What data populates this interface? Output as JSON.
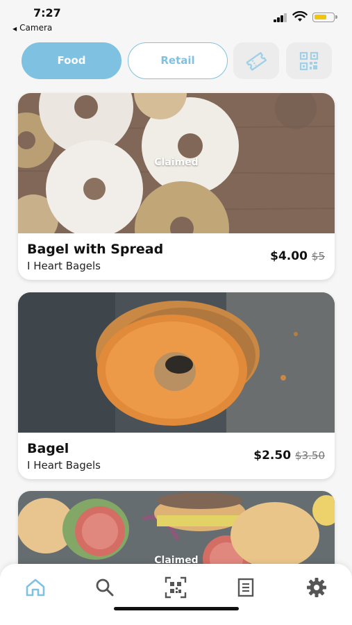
{
  "status_bar": {
    "time": "7:27",
    "back_app": "Camera",
    "back_glyph": "◀",
    "battery_color": "#f1c40f"
  },
  "tabs": {
    "food_label": "Food",
    "retail_label": "Retail",
    "ticket_icon": "ticket-icon",
    "qr_icon": "qr-code-icon"
  },
  "cards": [
    {
      "title": "Bagel with Spread",
      "vendor": "I Heart Bagels",
      "price": "$4.00",
      "old_price": "$5",
      "status": "Claimed"
    },
    {
      "title": "Bagel",
      "vendor": "I Heart Bagels",
      "price": "$2.50",
      "old_price": "$3.50",
      "status": ""
    },
    {
      "status": "Claimed"
    }
  ],
  "bottom_nav": {
    "items": [
      "home-icon",
      "search-icon",
      "qr-scan-icon",
      "orders-icon",
      "settings-icon"
    ],
    "active": "home-icon"
  },
  "colors": {
    "accent": "#7fc1e0",
    "icon_gray": "#555555"
  }
}
